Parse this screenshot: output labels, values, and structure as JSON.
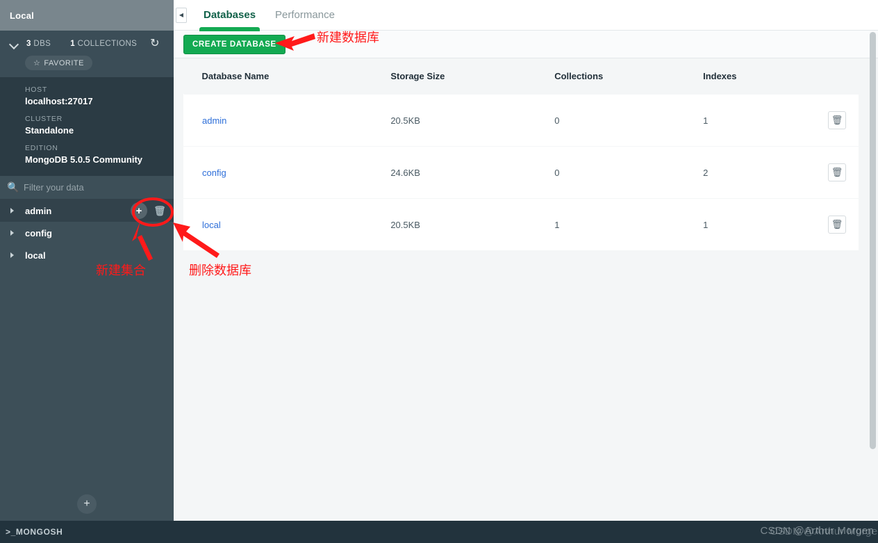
{
  "sidebar": {
    "connection_title": "Local",
    "stats": {
      "dbs_count": "3",
      "dbs_label": "DBS",
      "collections_count": "1",
      "collections_label": "COLLECTIONS",
      "refresh_icon": "refresh-icon",
      "caret_icon": "chevron-down-icon"
    },
    "favorite_label": "FAVORITE",
    "favorite_icon": "star-icon",
    "info": [
      {
        "label": "HOST",
        "value": "localhost:27017"
      },
      {
        "label": "CLUSTER",
        "value": "Standalone"
      },
      {
        "label": "EDITION",
        "value": "MongoDB 5.0.5 Community"
      }
    ],
    "filter": {
      "placeholder": "Filter your data",
      "value": "",
      "icon": "search-icon"
    },
    "databases": [
      {
        "name": "admin",
        "active": true
      },
      {
        "name": "config",
        "active": false
      },
      {
        "name": "local",
        "active": false
      }
    ],
    "db_actions": {
      "create_collection_icon": "plus-icon",
      "drop_database_icon": "trash-icon"
    },
    "add_connection_icon": "plus-icon"
  },
  "main": {
    "collapse_icon": "chevron-left-icon",
    "tabs": [
      {
        "label": "Databases",
        "active": true
      },
      {
        "label": "Performance",
        "active": false
      }
    ],
    "toolbar": {
      "create_database_label": "CREATE DATABASE"
    },
    "table": {
      "columns": [
        "Database Name",
        "Storage Size",
        "Collections",
        "Indexes"
      ],
      "rows": [
        {
          "name": "admin",
          "storage_size": "20.5KB",
          "collections": "0",
          "indexes": "1",
          "action_icon": "trash-icon"
        },
        {
          "name": "config",
          "storage_size": "24.6KB",
          "collections": "0",
          "indexes": "2",
          "action_icon": "trash-icon"
        },
        {
          "name": "local",
          "storage_size": "20.5KB",
          "collections": "1",
          "indexes": "1",
          "action_icon": "trash-icon"
        }
      ]
    }
  },
  "statusbar": {
    "mongosh_label": ">_MONGOSH",
    "watermark": "CSDN @Arthur Morgen"
  },
  "annotations": [
    {
      "id": "create-db",
      "text": "新建数据库"
    },
    {
      "id": "new-coll",
      "text": "新建集合"
    },
    {
      "id": "drop-db",
      "text": "删除数据库"
    }
  ],
  "colors": {
    "sidebar_bg": "#3d4f58",
    "sidebar_header": "#79868d",
    "sidebar_info_bg": "#2b3b44",
    "accent_green": "#13aa52",
    "link_blue": "#2e6fd9",
    "annotation_red": "#ff1a1a",
    "statusbar_bg": "#22333d"
  }
}
